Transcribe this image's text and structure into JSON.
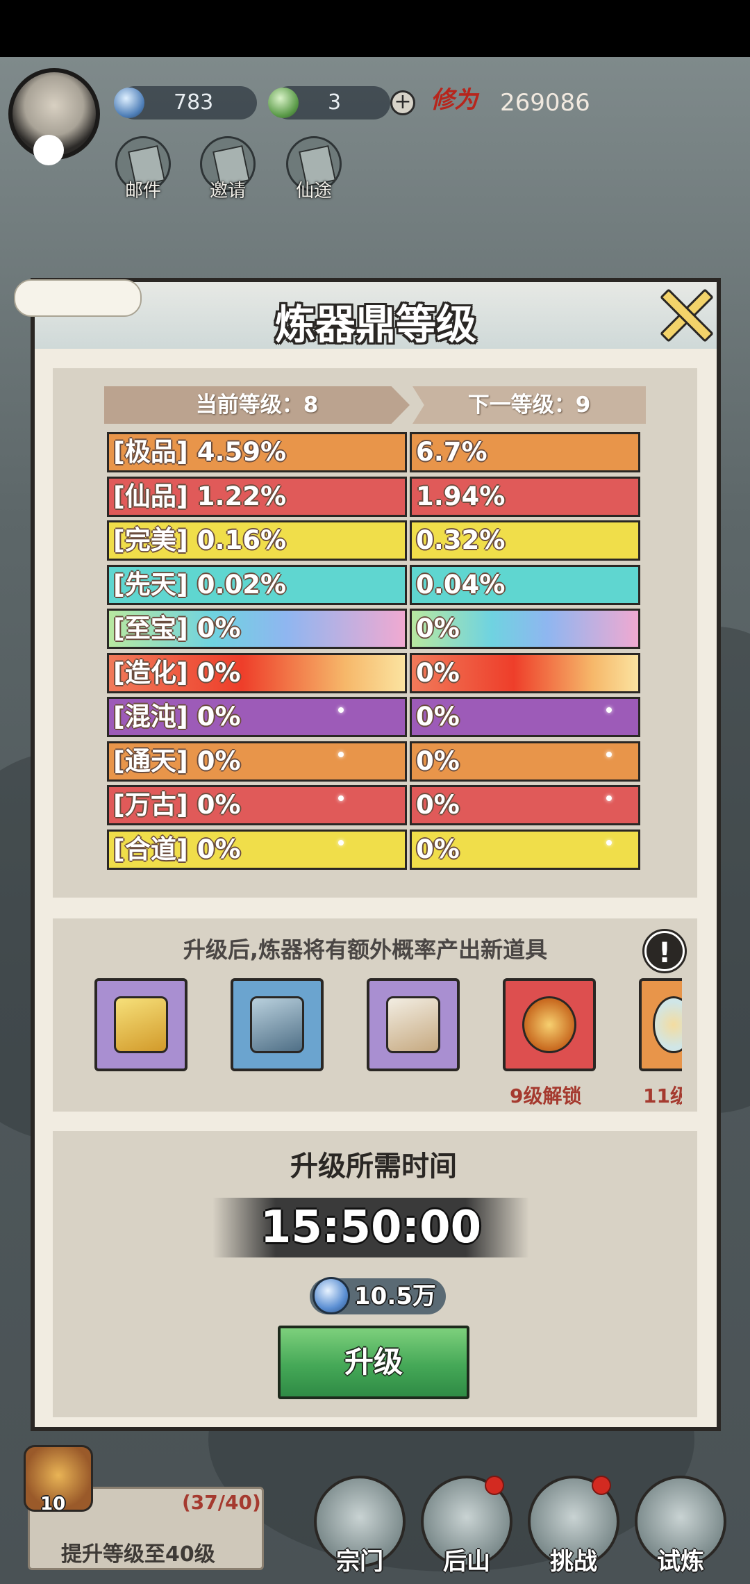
{
  "hud": {
    "resource_1": "783",
    "resource_2": "3",
    "xiuwei_label": "修为",
    "xiuwei_value": "269086",
    "buttons": [
      "邮件",
      "邀请",
      "仙途"
    ]
  },
  "dialog": {
    "title": "炼器鼎等级",
    "current_level_label": "当前等级：8",
    "next_level_label": "下一等级：9",
    "rows": [
      {
        "current": "[极品] 4.59%",
        "next": "6.7%",
        "color": "#e8954a"
      },
      {
        "current": "[仙品] 1.22%",
        "next": "1.94%",
        "color": "#e05a59"
      },
      {
        "current": "[完美] 0.16%",
        "next": "0.32%",
        "color": "#f0de4a"
      },
      {
        "current": "[先天] 0.02%",
        "next": "0.04%",
        "color": "#5fd6d0"
      },
      {
        "current": "[至宝] 0%",
        "next": "0%",
        "color": "rainbow"
      },
      {
        "current": "[造化] 0%",
        "next": "0%",
        "color": "fire"
      },
      {
        "current": "[混沌] 0%",
        "next": "0%",
        "color": "#9d5bb8"
      },
      {
        "current": "[通天] 0%",
        "next": "0%",
        "color": "#e8954a"
      },
      {
        "current": "[万古] 0%",
        "next": "0%",
        "color": "#e05a59"
      },
      {
        "current": "[合道] 0%",
        "next": "0%",
        "color": "#f0de4a"
      }
    ],
    "reward_title": "升级后,炼器将有额外概率产出新道具",
    "reward_items": [
      {
        "icon": "gold-token-icon",
        "unlock": ""
      },
      {
        "icon": "cauldron-machine-icon",
        "unlock": ""
      },
      {
        "icon": "flour-sack-icon",
        "unlock": ""
      },
      {
        "icon": "flame-orb-icon",
        "unlock": "9级解锁"
      },
      {
        "icon": "bowl-icon",
        "unlock": "11级"
      }
    ],
    "time_title": "升级所需时间",
    "timer": "15:50:00",
    "cost": "10.5万",
    "upgrade_label": "升级"
  },
  "bottom": {
    "chest_count": "10",
    "task_progress": "(37/40)",
    "task_text": "提升等级至40级",
    "nav": [
      "宗门",
      "后山",
      "挑战",
      "试炼"
    ]
  }
}
